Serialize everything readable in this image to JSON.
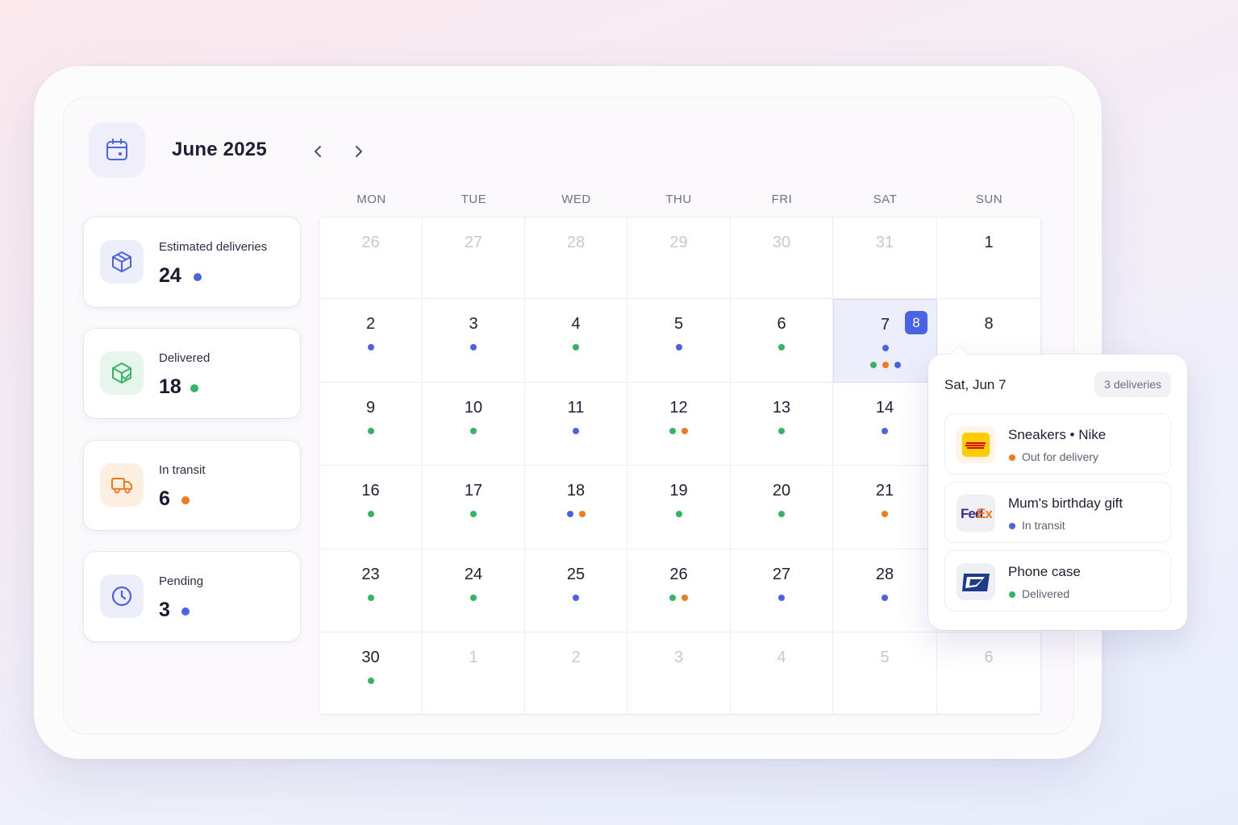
{
  "header": {
    "month_title": "June 2025",
    "prev_icon": "chevron-left-icon",
    "next_icon": "chevron-right-icon",
    "calendar_icon": "calendar-icon"
  },
  "colors": {
    "accent": "#4a63e4",
    "green": "#34b563",
    "orange": "#f07a1e",
    "blue": "#4a63e4"
  },
  "stats": [
    {
      "label": "Estimated deliveries",
      "value": "24",
      "icon": "box-icon",
      "dot": "blue"
    },
    {
      "label": "Delivered",
      "value": "18",
      "icon": "box-check-icon",
      "dot": "green"
    },
    {
      "label": "In transit",
      "value": "6",
      "icon": "truck-icon",
      "dot": "orange"
    },
    {
      "label": "Pending",
      "value": "3",
      "icon": "clock-icon",
      "dot": "blue"
    }
  ],
  "weekdays": [
    "MON",
    "TUE",
    "WED",
    "THU",
    "FRI",
    "SAT",
    "SUN"
  ],
  "weeks": [
    [
      {
        "d": "26",
        "m": true,
        "dots": []
      },
      {
        "d": "27",
        "m": true,
        "dots": []
      },
      {
        "d": "28",
        "m": true,
        "dots": []
      },
      {
        "d": "29",
        "m": true,
        "dots": []
      },
      {
        "d": "30",
        "m": true,
        "dots": []
      },
      {
        "d": "31",
        "m": true,
        "dots": []
      },
      {
        "d": "1",
        "dots": []
      }
    ],
    [
      {
        "d": "2",
        "dots": [
          "blue"
        ]
      },
      {
        "d": "3",
        "dots": [
          "blue"
        ]
      },
      {
        "d": "4",
        "dots": [
          "green"
        ]
      },
      {
        "d": "5",
        "dots": [
          "blue"
        ]
      },
      {
        "d": "6",
        "dots": [
          "green"
        ]
      },
      {
        "d": "7",
        "dots": [
          "blue"
        ],
        "dots2": [
          "green",
          "orange",
          "blue"
        ],
        "selected": true,
        "badge": "8"
      },
      {
        "d": "8",
        "dots": []
      }
    ],
    [
      {
        "d": "9",
        "dots": [
          "green"
        ]
      },
      {
        "d": "10",
        "dots": [
          "green"
        ]
      },
      {
        "d": "11",
        "dots": [
          "blue"
        ]
      },
      {
        "d": "12",
        "dots": [
          "green",
          "orange"
        ]
      },
      {
        "d": "13",
        "dots": [
          "green"
        ]
      },
      {
        "d": "14",
        "dots": [
          "blue"
        ]
      },
      {
        "d": "",
        "dots": []
      }
    ],
    [
      {
        "d": "16",
        "dots": [
          "green"
        ]
      },
      {
        "d": "17",
        "dots": [
          "green"
        ]
      },
      {
        "d": "18",
        "dots": [
          "blue",
          "orange"
        ]
      },
      {
        "d": "19",
        "dots": [
          "green"
        ]
      },
      {
        "d": "20",
        "dots": [
          "green"
        ]
      },
      {
        "d": "21",
        "dots": [
          "orange"
        ]
      },
      {
        "d": "",
        "dots": []
      }
    ],
    [
      {
        "d": "23",
        "dots": [
          "green"
        ]
      },
      {
        "d": "24",
        "dots": [
          "green"
        ]
      },
      {
        "d": "25",
        "dots": [
          "blue"
        ]
      },
      {
        "d": "26",
        "dots": [
          "green",
          "orange"
        ]
      },
      {
        "d": "27",
        "dots": [
          "blue"
        ]
      },
      {
        "d": "28",
        "dots": [
          "blue"
        ]
      },
      {
        "d": "",
        "dots": []
      }
    ],
    [
      {
        "d": "30",
        "dots": [
          "green"
        ]
      },
      {
        "d": "1",
        "m": true,
        "dots": []
      },
      {
        "d": "2",
        "m": true,
        "dots": []
      },
      {
        "d": "3",
        "m": true,
        "dots": []
      },
      {
        "d": "4",
        "m": true,
        "dots": []
      },
      {
        "d": "5",
        "m": true,
        "dots": []
      },
      {
        "d": "6",
        "m": true,
        "dots": []
      }
    ]
  ],
  "popover": {
    "title": "Sat, Jun 7",
    "count_label": "3 deliveries",
    "items": [
      {
        "title": "Sneakers • Nike",
        "status": "Out for delivery",
        "status_color": "orange",
        "carrier": "DHL",
        "logo_icon": "dhl-logo-icon"
      },
      {
        "title": "Mum's birthday gift",
        "status": "In transit",
        "status_color": "blue",
        "carrier": "FedEx",
        "logo_icon": "fedex-logo-icon"
      },
      {
        "title": "Phone case",
        "status": "Delivered",
        "status_color": "green",
        "carrier": "USPS",
        "logo_icon": "usps-logo-icon"
      }
    ]
  }
}
